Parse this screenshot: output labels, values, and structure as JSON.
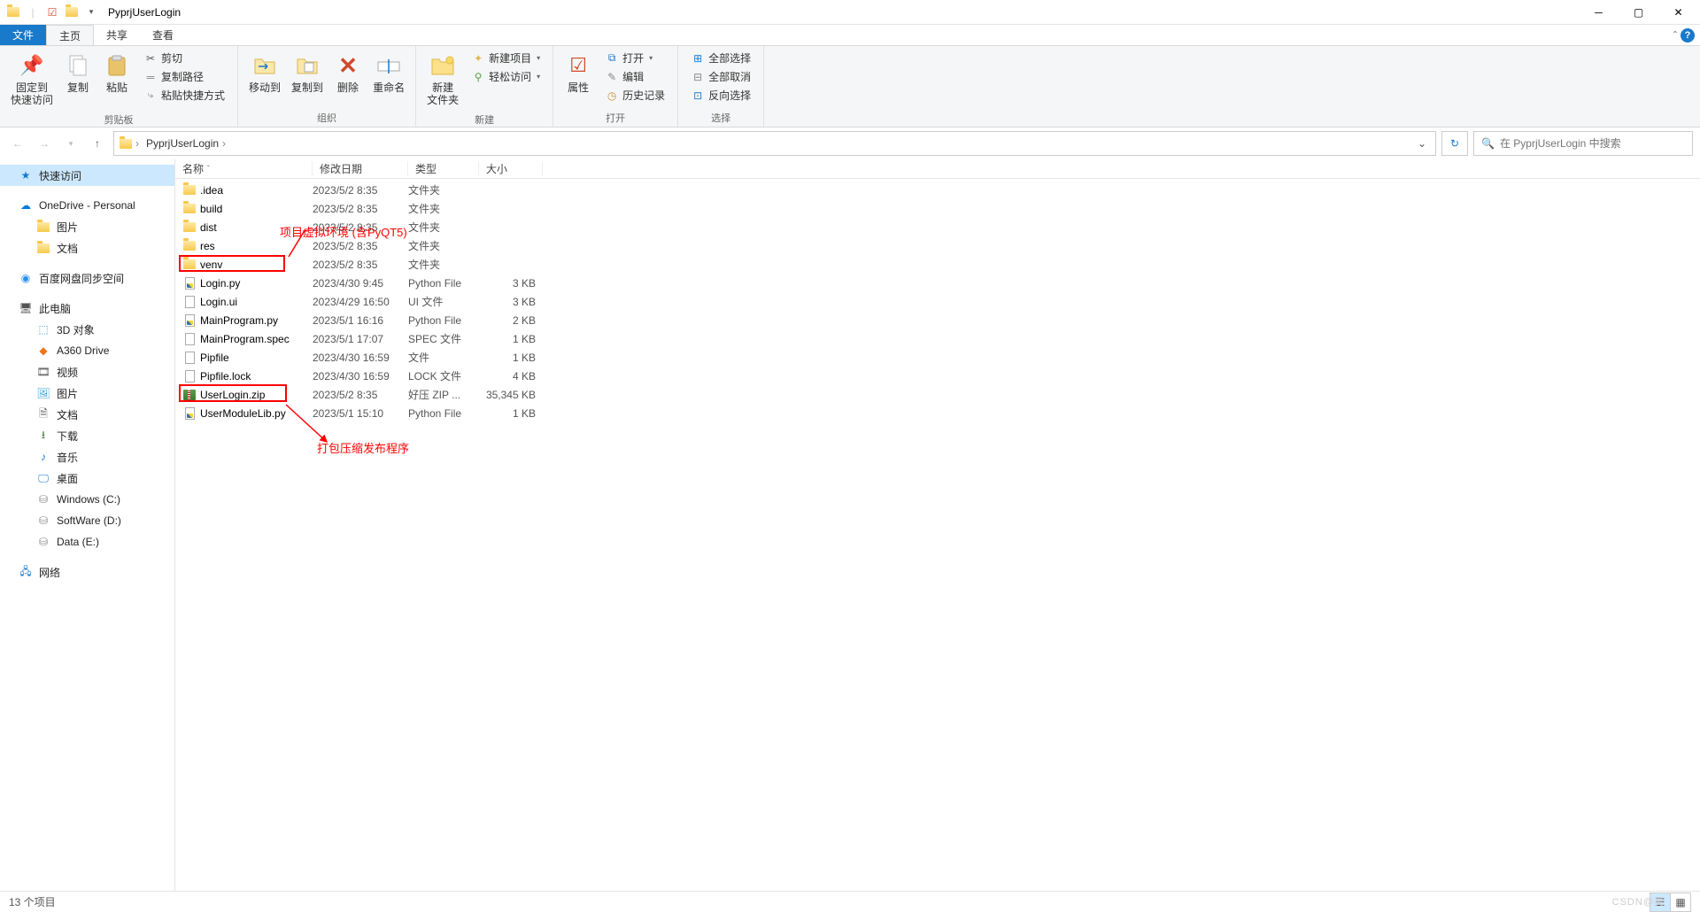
{
  "window": {
    "title": "PyprjUserLogin"
  },
  "tabs": {
    "file": "文件",
    "home": "主页",
    "share": "共享",
    "view": "查看"
  },
  "ribbon": {
    "pin": {
      "label1": "固定到",
      "label2": "快速访问"
    },
    "copy": "复制",
    "paste": "粘贴",
    "cut": "剪切",
    "copypath": "复制路径",
    "pasteshortcut": "粘贴快捷方式",
    "clipboard": "剪贴板",
    "moveto": "移动到",
    "copyto": "复制到",
    "delete": "删除",
    "rename": "重命名",
    "organize": "组织",
    "newfolder1": "新建",
    "newfolder2": "文件夹",
    "newitem": "新建项目",
    "easyaccess": "轻松访问",
    "new": "新建",
    "properties": "属性",
    "open": "打开",
    "edit": "编辑",
    "history": "历史记录",
    "opengroup": "打开",
    "selectall": "全部选择",
    "selectnone": "全部取消",
    "invertsel": "反向选择",
    "select": "选择"
  },
  "breadcrumb": {
    "folder": "PyprjUserLogin"
  },
  "search": {
    "placeholder": "在 PyprjUserLogin 中搜索"
  },
  "sidebar": {
    "quick": "快速访问",
    "onedrive": "OneDrive - Personal",
    "pictures": "图片",
    "documents": "文档",
    "baidu": "百度网盘同步空间",
    "thispc": "此电脑",
    "objects3d": "3D 对象",
    "a360": "A360 Drive",
    "videos": "视频",
    "pictures2": "图片",
    "documents2": "文档",
    "downloads": "下载",
    "music": "音乐",
    "desktop": "桌面",
    "windowsc": "Windows (C:)",
    "softwared": "SoftWare (D:)",
    "datae": "Data (E:)",
    "network": "网络"
  },
  "columns": {
    "name": "名称",
    "date": "修改日期",
    "type": "类型",
    "size": "大小"
  },
  "files": [
    {
      "name": ".idea",
      "date": "2023/5/2 8:35",
      "type": "文件夹",
      "size": "",
      "icon": "folder"
    },
    {
      "name": "build",
      "date": "2023/5/2 8:35",
      "type": "文件夹",
      "size": "",
      "icon": "folder"
    },
    {
      "name": "dist",
      "date": "2023/5/2 8:35",
      "type": "文件夹",
      "size": "",
      "icon": "folder"
    },
    {
      "name": "res",
      "date": "2023/5/2 8:35",
      "type": "文件夹",
      "size": "",
      "icon": "folder"
    },
    {
      "name": "venv",
      "date": "2023/5/2 8:35",
      "type": "文件夹",
      "size": "",
      "icon": "folder"
    },
    {
      "name": "Login.py",
      "date": "2023/4/30 9:45",
      "type": "Python File",
      "size": "3 KB",
      "icon": "py"
    },
    {
      "name": "Login.ui",
      "date": "2023/4/29 16:50",
      "type": "UI 文件",
      "size": "3 KB",
      "icon": "file"
    },
    {
      "name": "MainProgram.py",
      "date": "2023/5/1 16:16",
      "type": "Python File",
      "size": "2 KB",
      "icon": "py"
    },
    {
      "name": "MainProgram.spec",
      "date": "2023/5/1 17:07",
      "type": "SPEC 文件",
      "size": "1 KB",
      "icon": "file"
    },
    {
      "name": "Pipfile",
      "date": "2023/4/30 16:59",
      "type": "文件",
      "size": "1 KB",
      "icon": "file"
    },
    {
      "name": "Pipfile.lock",
      "date": "2023/4/30 16:59",
      "type": "LOCK 文件",
      "size": "4 KB",
      "icon": "file"
    },
    {
      "name": "UserLogin.zip",
      "date": "2023/5/2 8:35",
      "type": "好压 ZIP ...",
      "size": "35,345 KB",
      "icon": "zip"
    },
    {
      "name": "UserModuleLib.py",
      "date": "2023/5/1 15:10",
      "type": "Python File",
      "size": "1 KB",
      "icon": "py"
    }
  ],
  "annotations": {
    "venv_note": "项目虚拟环境 (含PyQT5)",
    "zip_note": "打包压缩发布程序"
  },
  "status": {
    "count": "13 个项目"
  },
  "watermark": "CSDN@昊"
}
